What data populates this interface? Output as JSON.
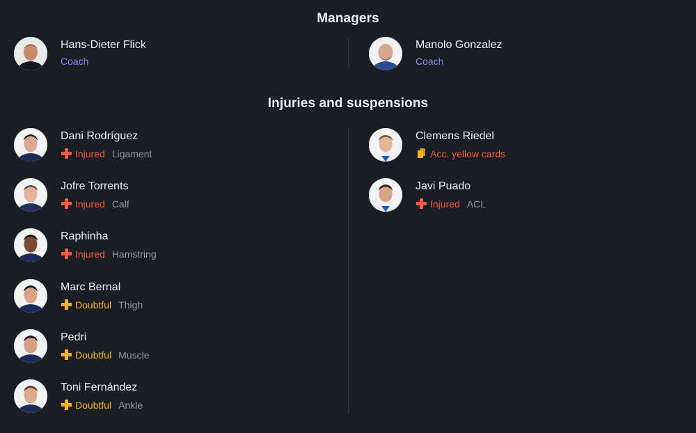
{
  "managers": {
    "title": "Managers",
    "items": [
      {
        "name": "Hans-Dieter Flick",
        "role": "Coach"
      },
      {
        "name": "Manolo Gonzalez",
        "role": "Coach"
      }
    ]
  },
  "injuries": {
    "title": "Injuries and suspensions",
    "left": [
      {
        "name": "Dani Rodríguez",
        "status": "Injured",
        "reason": "Ligament"
      },
      {
        "name": "Jofre Torrents",
        "status": "Injured",
        "reason": "Calf"
      },
      {
        "name": "Raphinha",
        "status": "Injured",
        "reason": "Hamstring"
      },
      {
        "name": "Marc Bernal",
        "status": "Doubtful",
        "reason": "Thigh"
      },
      {
        "name": "Pedri",
        "status": "Doubtful",
        "reason": "Muscle"
      },
      {
        "name": "Toni Fernández",
        "status": "Doubtful",
        "reason": "Ankle"
      }
    ],
    "right": [
      {
        "name": "Clemens Riedel",
        "status": "Acc. yellow cards",
        "reason": ""
      },
      {
        "name": "Javi Puado",
        "status": "Injured",
        "reason": "ACL"
      }
    ]
  },
  "icons": {
    "injured": "red-cross-icon",
    "doubtful": "yellow-cross-icon",
    "suspended": "yellow-cards-icon"
  },
  "colors": {
    "background": "#1a1d21",
    "coach": "#7f8cf5",
    "injured": "#ee5a4c",
    "doubtful": "#f0b42a",
    "reason": "#93979c"
  }
}
